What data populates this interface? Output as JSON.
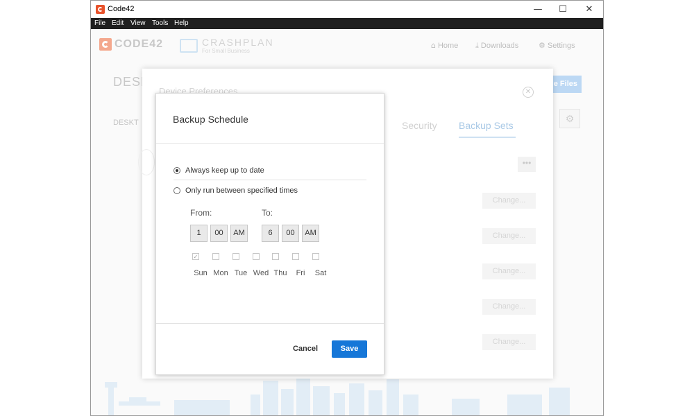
{
  "window": {
    "title": "Code42",
    "minimize": "—",
    "maximize": "☐",
    "close": "✕"
  },
  "menu": [
    "File",
    "Edit",
    "View",
    "Tools",
    "Help"
  ],
  "header": {
    "brand": "CODE42",
    "product": "CRASHPLAN",
    "product_sub": "For Small Business",
    "nav": [
      {
        "label": "Home",
        "icon": "home-icon"
      },
      {
        "label": "Downloads",
        "icon": "download-icon"
      },
      {
        "label": "Settings",
        "icon": "gear-icon"
      }
    ]
  },
  "background_page": {
    "title": "DESKT",
    "tab": "DESKT",
    "files_button": "e Files"
  },
  "device_preferences": {
    "title": "Device Preferences",
    "tabs": [
      "Security",
      "Backup Sets"
    ],
    "active_tab": "Backup Sets",
    "more": "•••",
    "change_buttons": [
      "Change...",
      "Change...",
      "Change...",
      "Change...",
      "Change..."
    ]
  },
  "backup_schedule": {
    "title": "Backup Schedule",
    "options": [
      {
        "label": "Always keep up to date",
        "selected": true
      },
      {
        "label": "Only run between specified times",
        "selected": false
      }
    ],
    "from_label": "From:",
    "to_label": "To:",
    "from": {
      "hour": "1",
      "minute": "00",
      "ampm": "AM"
    },
    "to": {
      "hour": "6",
      "minute": "00",
      "ampm": "AM"
    },
    "days": [
      {
        "label": "Sun",
        "checked": true
      },
      {
        "label": "Mon",
        "checked": false
      },
      {
        "label": "Tue",
        "checked": false
      },
      {
        "label": "Wed",
        "checked": false
      },
      {
        "label": "Thu",
        "checked": false
      },
      {
        "label": "Fri",
        "checked": false
      },
      {
        "label": "Sat",
        "checked": false
      }
    ],
    "cancel": "Cancel",
    "save": "Save"
  },
  "colors": {
    "accent": "#1677d8",
    "brand": "#e8522b",
    "menubar": "#1f1f1f"
  }
}
